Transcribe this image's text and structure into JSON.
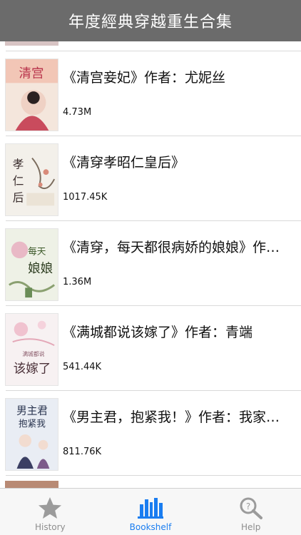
{
  "header": {
    "title": "年度經典穿越重生合集"
  },
  "books": [
    {
      "title": "《清宫妾妃》作者：尤妮丝",
      "size": "4.73M"
    },
    {
      "title": "《清穿孝昭仁皇后》",
      "size": "1017.45K"
    },
    {
      "title": "《清穿，每天都很病娇的娘娘》作者：…",
      "size": "1.36M"
    },
    {
      "title": "《满城都说该嫁了》作者：青端",
      "size": "541.44K"
    },
    {
      "title": "《男主君，抱紧我！》作者：我家…",
      "size": "811.76K"
    }
  ],
  "tabs": [
    {
      "label": "History",
      "icon": "star-icon",
      "active": false
    },
    {
      "label": "Bookshelf",
      "icon": "bookshelf-icon",
      "active": true
    },
    {
      "label": "Help",
      "icon": "magnifier-icon",
      "active": false
    }
  ],
  "colors": {
    "nav_bg": "#6b6b6b",
    "active_tab": "#1a7df0",
    "inactive_tab": "#8e8e8e"
  }
}
